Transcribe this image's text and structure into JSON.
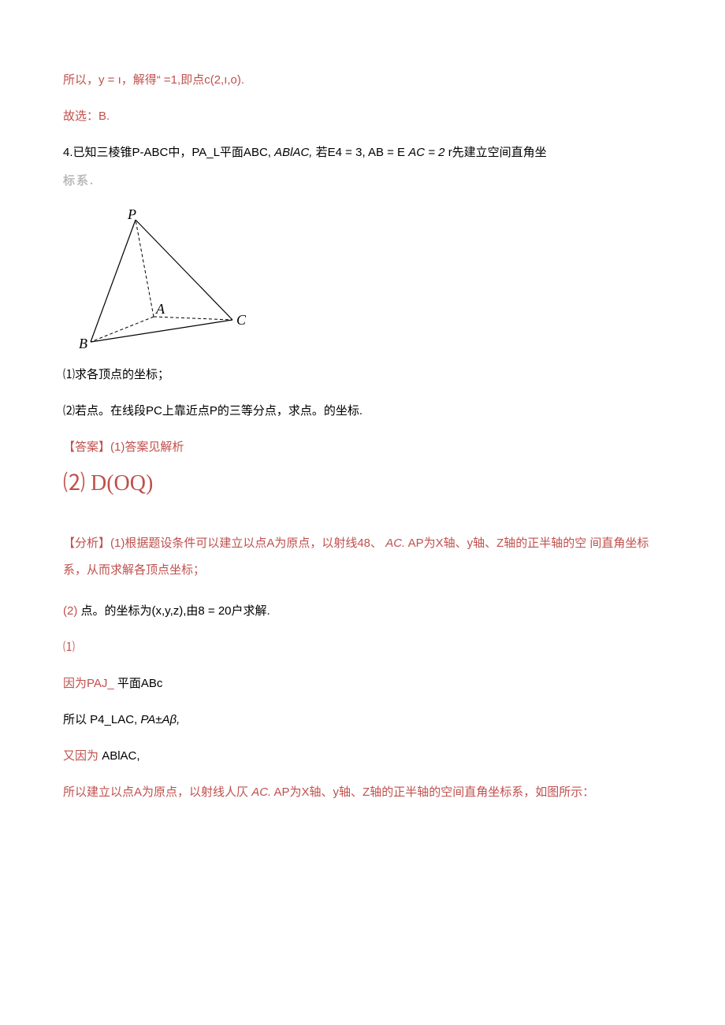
{
  "l1": "所以，y = ı，解得“ =1,即点c(2,ı,o).",
  "l2": "故选：B.",
  "l3_pre": "4.已知三棱锥P-ABC中，PA_L平面ABC, ",
  "l3_ital": "ABlAC,",
  "l3_post": "若E4 = 3, AB = E ",
  "l3_ital2": "AC = 2",
  "l3_end": "r先建立空间直角坐",
  "l4": "标系.",
  "labels": {
    "P": "P",
    "A": "A",
    "B": "B",
    "C": "C"
  },
  "q1": "⑴求各顶点的坐标；",
  "q2": "⑵若点。在线段PC上靠近点P的三等分点，求点。的坐标.",
  "ans_label": "【答案】(1)答案见解析",
  "formula_num": "⑵",
  "formula_body": " D(OQ)",
  "an1a": "【分析】(1)根据题设条件可以建立以点A为原点，以射线48、",
  "an1b": "AC.",
  "an1c": " AP为X轴、y轴、Z轴的正半轴的空 间直角坐标系，从而求解各顶点坐标；",
  "an2a": "(2)",
  "an2b": "点。的坐标为(x,y,z),由8 = 20户求解.",
  "s1": "⑴",
  "s2a": "因为PAJ_",
  "s2b": "平面ABc",
  "s3a": "所以 ",
  "s3b": " P4_LAC, ",
  "s3c": "PA±Aβ,",
  "s4a": "又因为",
  "s4b": "ABlAC,",
  "s5a": "所以建立以点A为原点，以射线人仄",
  "s5b": "AC.",
  "s5c": " AP为X轴、y轴、Z轴的正半轴的空间直角坐标系，如图所示："
}
